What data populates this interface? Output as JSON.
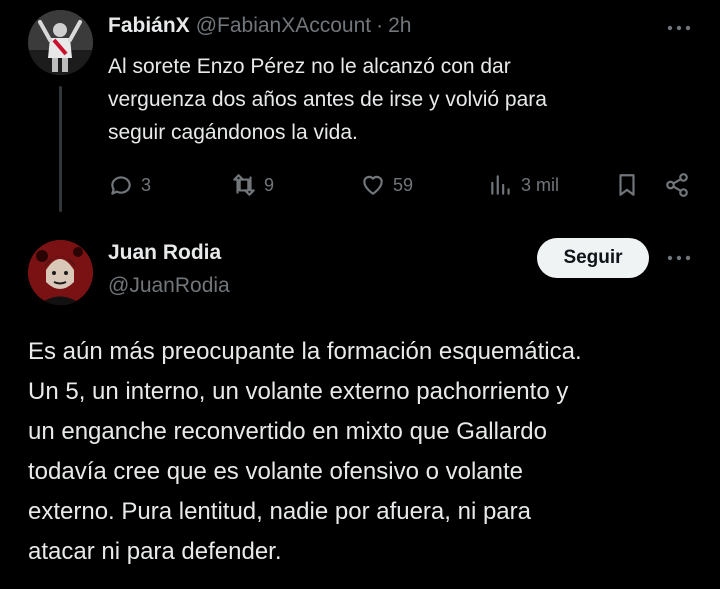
{
  "tweet": {
    "author_name": "FabiánX",
    "author_handle": "@FabianXAccount",
    "separator": "·",
    "time": "2h",
    "text": "Al sorete Enzo Pérez no le alcanzó con dar\nverguenza dos años antes de irse y volvió para\nseguir cagándonos la vida.",
    "actions": {
      "replies": "3",
      "retweets": "9",
      "likes": "59",
      "views": "3 mil"
    }
  },
  "reply": {
    "author_name": "Juan Rodia",
    "author_handle": "@JuanRodia",
    "follow_label": "Seguir",
    "text": "Es aún más preocupante la formación esquemática.\nUn 5, un interno, un volante externo pachorriento y\nun enganche reconvertido en mixto que Gallardo\ntodavía cree que es volante ofensivo o volante\nexterno. Pura lentitud, nadie por afuera, ni para\natacar ni para defender."
  },
  "colors": {
    "background": "#000000",
    "primary_text": "#e7e9ea",
    "secondary_text": "#71767b",
    "follow_button_bg": "#eff3f4",
    "follow_button_text": "#0f1419"
  },
  "icons": [
    "more-icon",
    "reply-icon",
    "retweet-icon",
    "like-icon",
    "views-icon",
    "bookmark-icon",
    "share-icon"
  ]
}
